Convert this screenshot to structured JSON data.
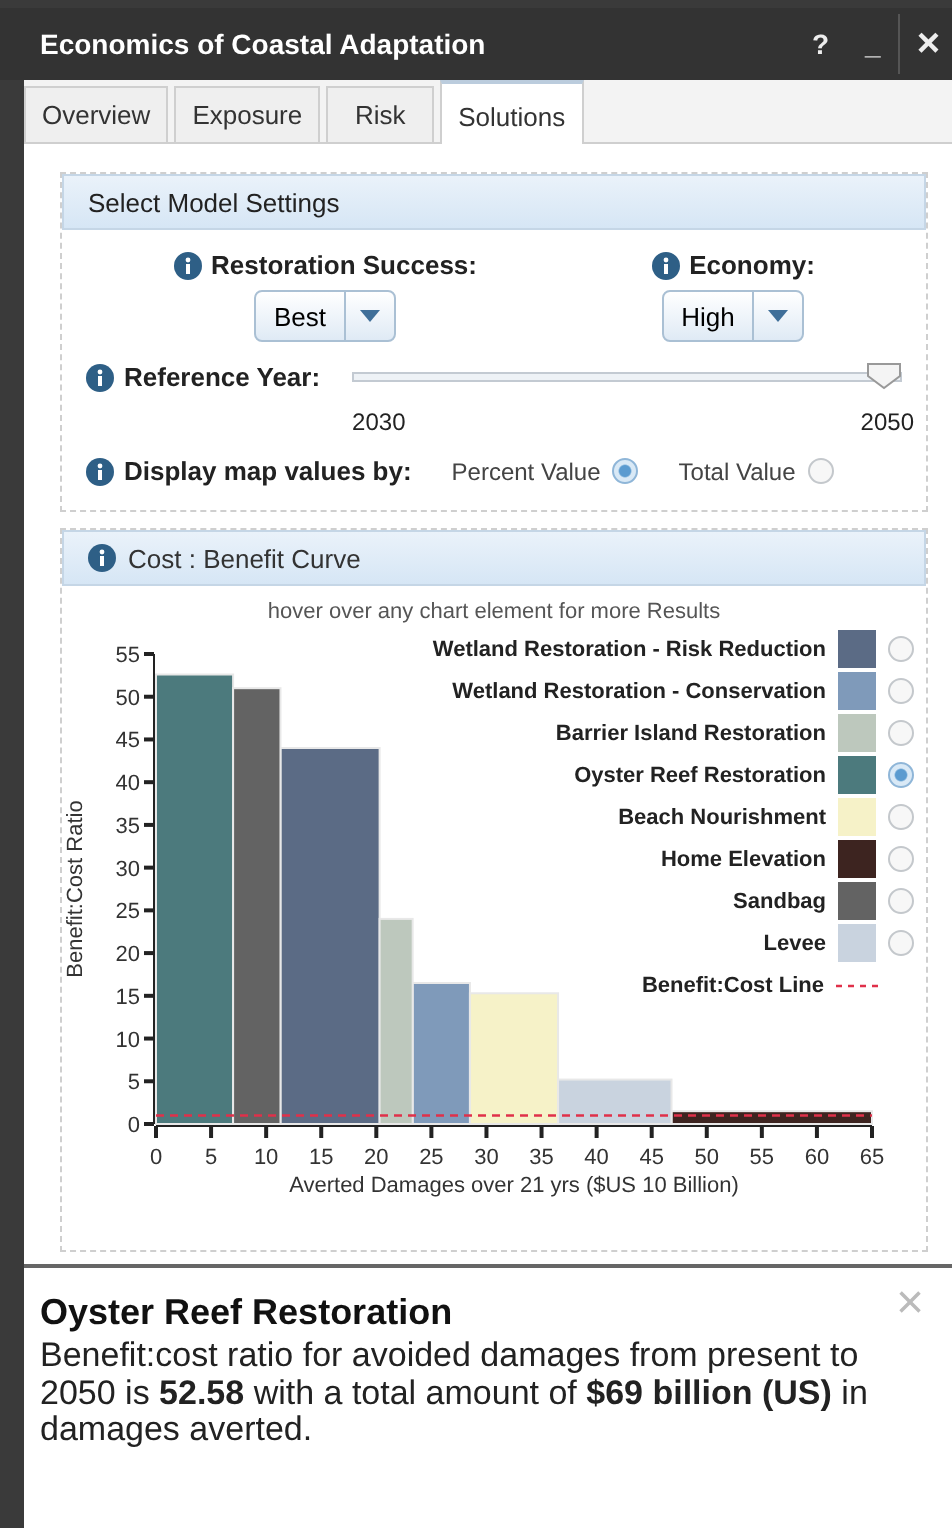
{
  "window": {
    "title": "Economics of Coastal Adaptation",
    "buttons": [
      {
        "kind": "help",
        "label": "?"
      },
      {
        "kind": "minimize",
        "label": "_"
      },
      {
        "kind": "close",
        "label": "×"
      }
    ]
  },
  "tabs": [
    {
      "label": "Overview",
      "selected": false
    },
    {
      "label": "Exposure",
      "selected": false
    },
    {
      "label": "Risk",
      "selected": false
    },
    {
      "label": "Solutions",
      "selected": true
    }
  ],
  "settings": {
    "title": "Select Model Settings",
    "dropdowns": [
      {
        "label": "Restoration Success:",
        "value": "Best"
      },
      {
        "label": "Economy:",
        "value": "High"
      }
    ],
    "reference_year": {
      "label": "Reference Year:",
      "min_label": "2030",
      "max_label": "2050",
      "level": 1
    },
    "display_by": {
      "label": "Display map values by:",
      "options": [
        {
          "label": "Percent Value",
          "selected": true
        },
        {
          "label": "Total Value",
          "selected": false
        }
      ]
    }
  },
  "chart_panel": {
    "title": "Cost : Benefit Curve",
    "hint": "hover over any chart element for more Results",
    "chart_data": {
      "type": "bar",
      "xlabel": "Averted Damages over 21 yrs ($US 10 Billion)",
      "ylabel": "Benefit:Cost Ratio",
      "x": [
        3.5,
        9.15,
        15.8,
        21.8,
        25.9,
        32.5,
        41.65,
        55.9
      ],
      "xlim": [
        0,
        65
      ],
      "ylim": [
        0,
        55
      ],
      "xticks": [
        0,
        5,
        10,
        15,
        20,
        25,
        30,
        35,
        40,
        45,
        50,
        55,
        60,
        65
      ],
      "yticks": [
        0,
        5,
        10,
        15,
        20,
        25,
        30,
        35,
        40,
        45,
        50,
        55
      ],
      "series": [
        {
          "name": "Wetland Restoration - Risk Reduction",
          "color": "#5b6b85",
          "values": [
            null,
            null,
            44,
            null,
            null,
            null,
            null,
            null
          ]
        },
        {
          "name": "Wetland Restoration - Conservation",
          "color": "#7f9aba",
          "values": [
            null,
            null,
            null,
            null,
            16.5,
            null,
            null,
            null
          ]
        },
        {
          "name": "Barrier Island Restoration",
          "color": "#bdc8bd",
          "values": [
            null,
            null,
            null,
            24,
            null,
            null,
            null,
            null
          ]
        },
        {
          "name": "Oyster Reef Restoration",
          "color": "#4c7a7d",
          "values": [
            52.6,
            null,
            null,
            null,
            null,
            null,
            null,
            null
          ]
        },
        {
          "name": "Beach Nourishment",
          "color": "#f6f2c8",
          "values": [
            null,
            null,
            null,
            null,
            null,
            15.3,
            null,
            null
          ]
        },
        {
          "name": "Home Elevation",
          "color": "#3d2420",
          "values": [
            null,
            null,
            null,
            null,
            null,
            null,
            null,
            1.5
          ]
        },
        {
          "name": "Sandbag",
          "color": "#636363",
          "values": [
            null,
            51,
            null,
            null,
            null,
            null,
            null,
            null
          ]
        },
        {
          "name": "Levee",
          "color": "#c9d3df",
          "values": [
            null,
            null,
            null,
            null,
            null,
            null,
            5.2,
            null
          ]
        }
      ],
      "legend": "upper right",
      "ref_lines": [
        {
          "axis": "y",
          "value": 1,
          "label": "Benefit:Cost Line",
          "color": "#e0304a"
        }
      ]
    },
    "legend_radios": [
      {
        "selected": false
      },
      {
        "selected": false
      },
      {
        "selected": false
      },
      {
        "selected": true
      },
      {
        "selected": false
      },
      {
        "selected": false
      },
      {
        "selected": false
      },
      {
        "selected": false
      }
    ]
  },
  "info": {
    "title": "Oyster Reef Restoration",
    "text": "Benefit:cost ratio for avoided damages from present to 2050 is **52.58** with a total amount of **$69 billion (US)** in damages averted.",
    "close": "×"
  }
}
